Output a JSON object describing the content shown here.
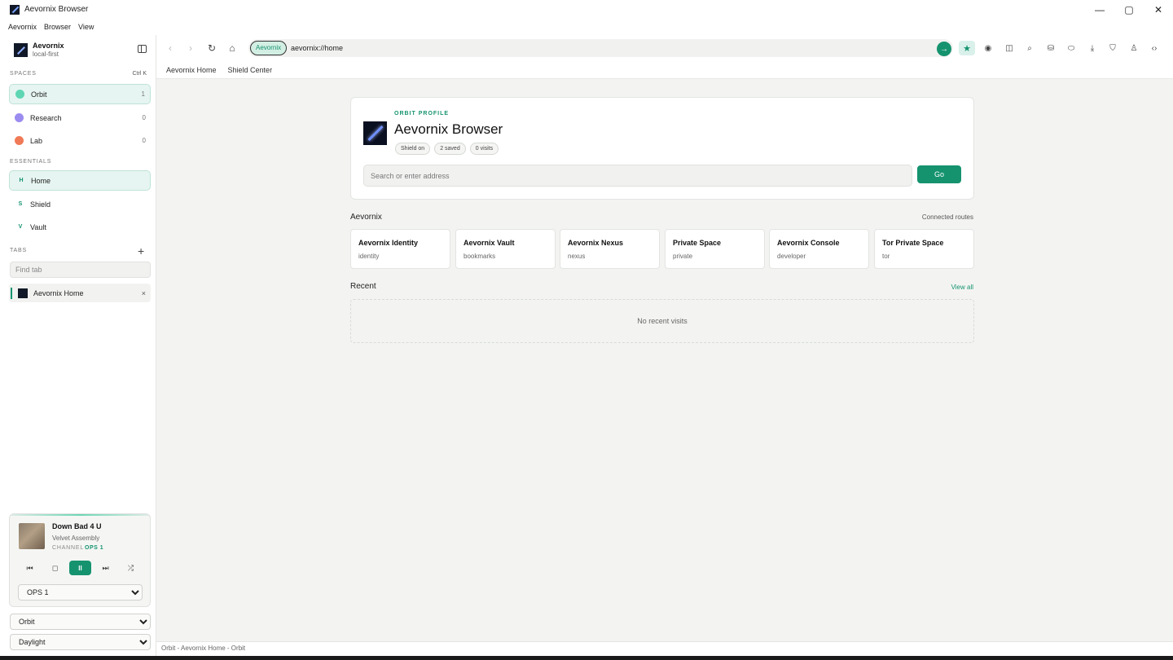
{
  "window": {
    "title": "Aevornix Browser",
    "controls": [
      "—",
      "▢",
      "✕"
    ]
  },
  "menu": [
    "Aevornix",
    "Browser",
    "View"
  ],
  "sidebar": {
    "profile": {
      "name": "Aevornix",
      "subtitle": "local-first"
    },
    "spaces_label": "SPACES",
    "spaces_hint": "Ctrl K",
    "spaces": [
      {
        "label": "Orbit",
        "count": "1",
        "color": "#5ed6b4"
      },
      {
        "label": "Research",
        "count": "0",
        "color": "#9b8cf0"
      },
      {
        "label": "Lab",
        "count": "0",
        "color": "#f07a57"
      }
    ],
    "essentials_label": "ESSENTIALS",
    "essentials": [
      {
        "letter": "H",
        "label": "Home"
      },
      {
        "letter": "S",
        "label": "Shield"
      },
      {
        "letter": "V",
        "label": "Vault"
      }
    ],
    "tabs_label": "TABS",
    "add_tab": "+",
    "find_tab_placeholder": "Find tab",
    "tabs": [
      {
        "label": "Aevornix Home",
        "close": "×"
      }
    ],
    "player": {
      "title": "Down Bad 4 U",
      "artist": "Velvet Assembly",
      "channel_label": "CHANNEL",
      "channel_value": "OPS 1",
      "controls": {
        "prev": "⏮",
        "stop": "◻",
        "pause": "II",
        "next": "⏭",
        "shuffle": "⤮"
      },
      "channel_select": "OPS 1"
    },
    "space_select": "Orbit",
    "theme_select": "Daylight"
  },
  "toolbar": {
    "back": "‹",
    "forward": "›",
    "reload": "↻",
    "home": "⌂",
    "badge": "Aevornix",
    "address": "aevornix://home",
    "go": "→",
    "icons": [
      "★",
      "◉",
      "◫",
      "⌕",
      "⛁",
      "⬭",
      "⤓",
      "⛉",
      "♙",
      "‹›"
    ]
  },
  "bookmarks": [
    "Aevornix Home",
    "Shield Center"
  ],
  "profile_card": {
    "eyebrow": "ORBIT PROFILE",
    "title": "Aevornix Browser",
    "chips": [
      "Shield on",
      "2 saved",
      "0 visits"
    ],
    "search_placeholder": "Search or enter address",
    "go_label": "Go"
  },
  "routes_section": {
    "title": "Aevornix",
    "right": "Connected routes",
    "routes": [
      {
        "title": "Aevornix Identity",
        "sub": "identity"
      },
      {
        "title": "Aevornix Vault",
        "sub": "bookmarks"
      },
      {
        "title": "Aevornix Nexus",
        "sub": "nexus"
      },
      {
        "title": "Private Space",
        "sub": "private"
      },
      {
        "title": "Aevornix Console",
        "sub": "developer"
      },
      {
        "title": "Tor Private Space",
        "sub": "tor"
      }
    ]
  },
  "recent_section": {
    "title": "Recent",
    "view_all": "View all",
    "empty": "No recent visits"
  },
  "status": "Orbit - Aevornix Home - Orbit",
  "colors": {
    "accent": "#15936f",
    "accent_light": "#e6f5f1"
  }
}
